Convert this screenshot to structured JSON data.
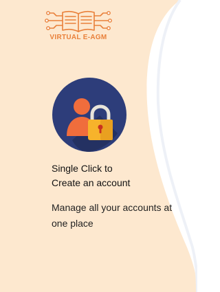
{
  "brand": {
    "name": "VIRTUAL E-AGM",
    "logo_icon": "open-book-circuit-icon",
    "accent_color": "#e9803a"
  },
  "hero": {
    "icon": "user-lock-icon",
    "title_line1": "Single Click to",
    "title_line2": "Create an account",
    "description_line1": "Manage all your accounts at",
    "description_line2": "one place"
  },
  "colors": {
    "panel_background": "#fde8cf",
    "avatar_circle": "#2d3d7a",
    "person": "#f06d3c",
    "lock": "#f7b32b"
  }
}
